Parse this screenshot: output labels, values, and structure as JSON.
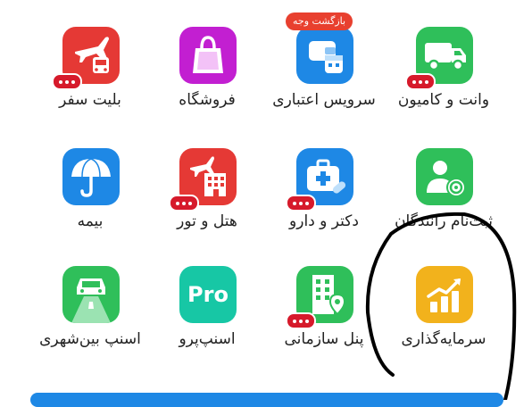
{
  "badge": "بازگشت وجه",
  "services": [
    {
      "label": "بلیت سفر",
      "icon": "airplane-bus-icon",
      "color": "#e53935",
      "menu": true
    },
    {
      "label": "فروشگاه",
      "icon": "shopping-bag-icon",
      "color": "#c21fd1",
      "menu": false
    },
    {
      "label": "سرویس اعتباری",
      "icon": "wallet-calendar-icon",
      "color": "#1e88e5",
      "menu": false
    },
    {
      "label": "وانت و کامیون",
      "icon": "truck-icon",
      "color": "#2fbf5a",
      "menu": true
    },
    {
      "label": "بیمه",
      "icon": "umbrella-icon",
      "color": "#1e88e5",
      "menu": false
    },
    {
      "label": "هتل و تور",
      "icon": "hotel-plane-icon",
      "color": "#e53935",
      "menu": true
    },
    {
      "label": "دکتر و دارو",
      "icon": "medical-kit-icon",
      "color": "#1e88e5",
      "menu": true
    },
    {
      "label": "ثبت‌نام رانندگان",
      "icon": "driver-wheel-icon",
      "color": "#2fbf5a",
      "menu": false
    },
    {
      "label": "اسنپ بین‌شهری",
      "icon": "car-road-icon",
      "color": "#2fbf5a",
      "menu": false
    },
    {
      "label": "اسنپ‌پرو",
      "icon": "pro-icon",
      "color": "#17c7a5",
      "pro_text": "Pro",
      "menu": false
    },
    {
      "label": "پنل سازمانی",
      "icon": "building-location-icon",
      "color": "#2fbf5a",
      "menu": true
    },
    {
      "label": "سرمایه‌گذاری",
      "icon": "investment-chart-icon",
      "color": "#f2b21c",
      "menu": false
    }
  ]
}
